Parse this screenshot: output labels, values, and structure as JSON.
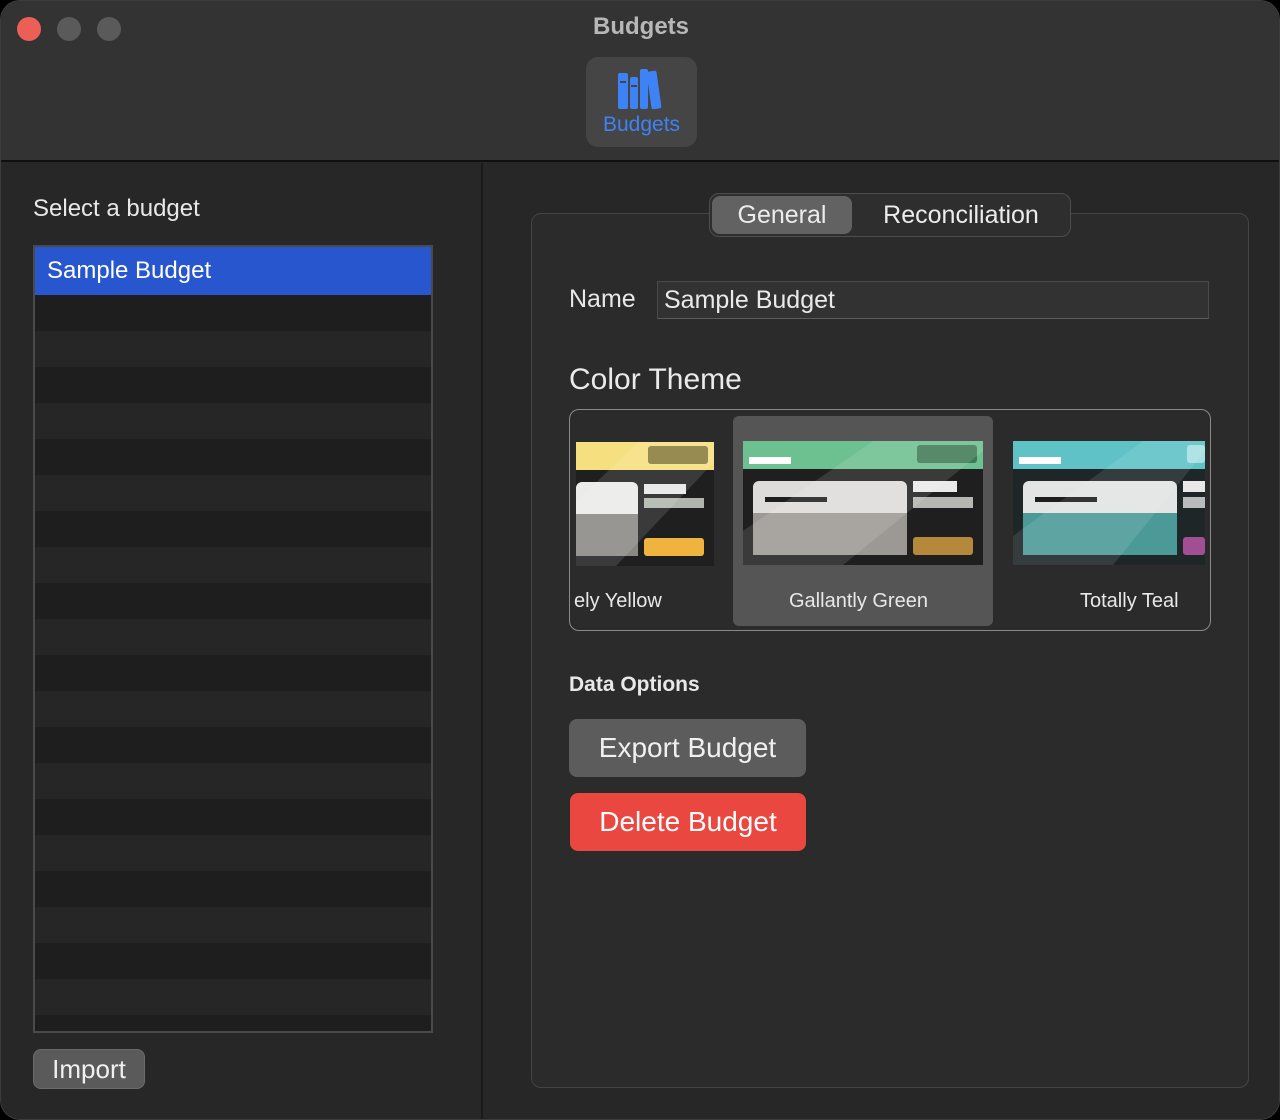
{
  "window": {
    "title": "Budgets",
    "traffic_lights": [
      "close",
      "minimize",
      "zoom"
    ]
  },
  "toolbar": {
    "items": [
      {
        "label": "Budgets",
        "icon": "books-icon",
        "selected": true,
        "color": "#3d83f6"
      }
    ]
  },
  "sidebar": {
    "heading": "Select a budget",
    "budgets": [
      {
        "name": "Sample Budget",
        "selected": true
      }
    ],
    "import_label": "Import"
  },
  "tabs": [
    {
      "label": "General",
      "selected": true
    },
    {
      "label": "Reconciliation",
      "selected": false
    }
  ],
  "general": {
    "name_label": "Name",
    "name_value": "Sample Budget",
    "color_theme_label": "Color Theme",
    "themes": [
      {
        "name": "ely Yellow",
        "accent": "#f6df7e",
        "button": "#f0b43e",
        "selected": false
      },
      {
        "name": "Gallantly Green",
        "accent": "#6dc090",
        "button": "#b4893c",
        "selected": true
      },
      {
        "name": "Totally Teal",
        "accent": "#5fc2c6",
        "button": "#a24e94",
        "selected": false
      }
    ],
    "data_options_label": "Data Options",
    "export_label": "Export Budget",
    "delete_label": "Delete Budget",
    "delete_color": "#e9473f"
  }
}
